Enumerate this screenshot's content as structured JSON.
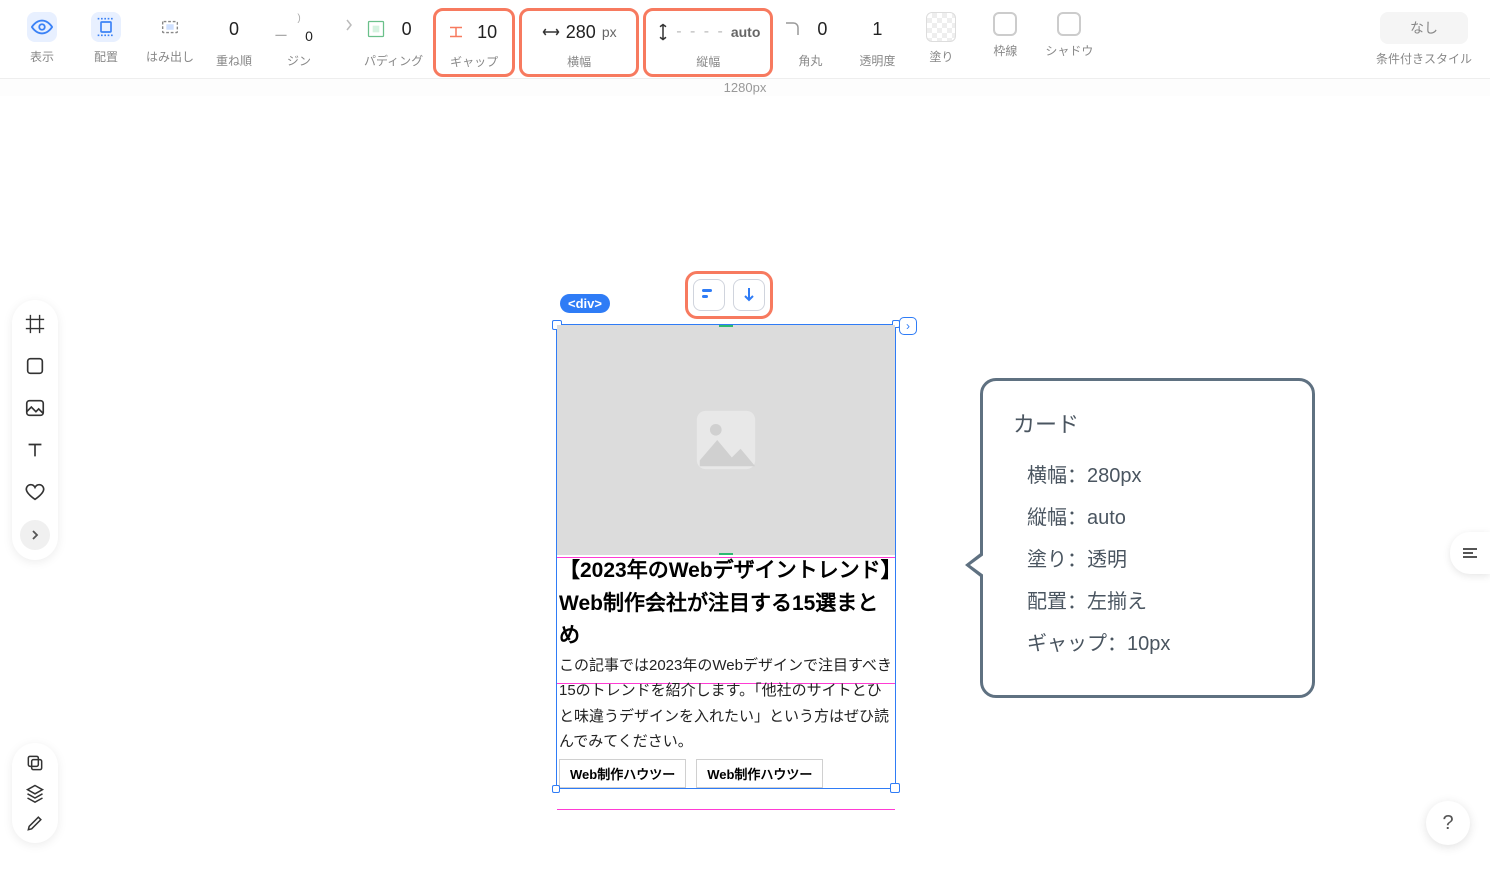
{
  "toolbar": {
    "display_label": "表示",
    "align_label": "配置",
    "overflow_label": "はみ出し",
    "zindex_label": "重ね順",
    "zindex_val": "0",
    "margin_label": "ジン",
    "margin_val1": "ー",
    "margin_val2": "0",
    "padding_label": "パディング",
    "padding_val": "0",
    "gap_label": "ギャップ",
    "gap_val": "10",
    "width_label": "横幅",
    "width_val": "280",
    "width_unit": "px",
    "height_label": "縦幅",
    "height_dash": "- - - -",
    "height_unit": "auto",
    "radius_label": "角丸",
    "radius_val": "0",
    "opacity_label": "透明度",
    "opacity_val": "1",
    "fill_label": "塗り",
    "border_label": "枠線",
    "shadow_label": "シャドウ",
    "conditional_label": "条件付きスタイル",
    "conditional_btn": "なし"
  },
  "ruler": {
    "label": "1280px"
  },
  "tag": {
    "div": "<div>"
  },
  "card": {
    "title": "【2023年のWebデザイントレンド】Web制作会社が注目する15選まとめ",
    "desc": "この記事では2023年のWebデザインで注目すべき15のトレンドを紹介します。「他社のサイトとひと味違うデザインを入れたい」という方はぜひ読んでみてください。",
    "tag1": "Web制作ハウツー",
    "tag2": "Web制作ハウツー"
  },
  "annot": {
    "title": "カード",
    "l1": "横幅：280px",
    "l2": "縦幅：auto",
    "l3": "塗り：透明",
    "l4": "配置：左揃え",
    "l5": "ギャップ：10px"
  },
  "help": "?"
}
